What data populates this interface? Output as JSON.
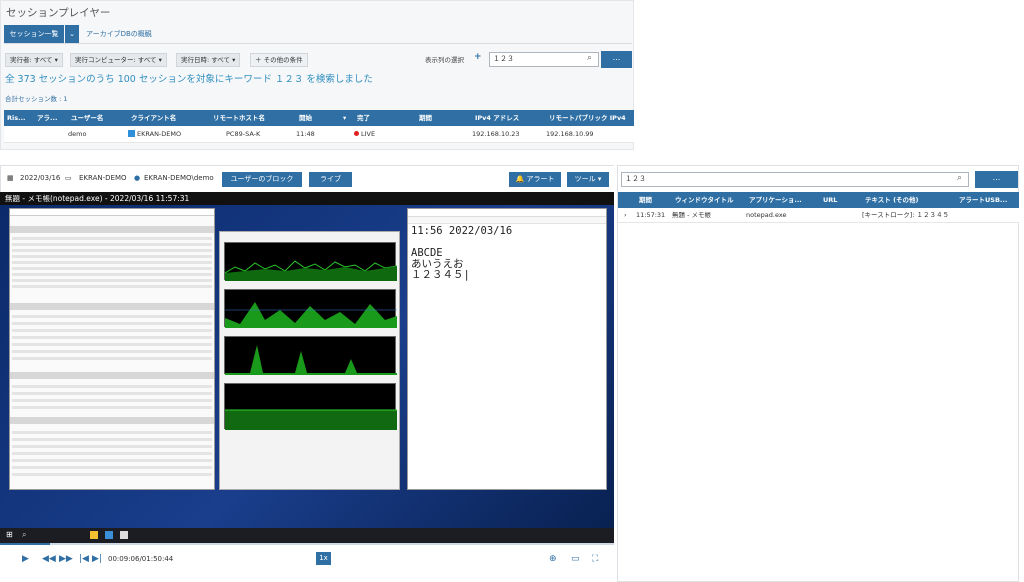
{
  "app": {
    "title": "セッションプレイヤー"
  },
  "tabs": {
    "sessions": "セッション一覧",
    "caret": "⌄",
    "archive": "アーカイブDBの概観"
  },
  "filters": [
    "実行者: すべて ▾",
    "実行コンピューター: すべて ▾",
    "実行日時: すべて ▾"
  ],
  "more_conditions": "＋ その他の条件",
  "columns_select": "表示列の選択",
  "columns_plus": "+",
  "search": {
    "value": "１２３",
    "button": "..."
  },
  "summary": "全 373 セッションのうち 100 セッションを対象にキーワード １２３ を検索しました",
  "total_sessions": "合計セッション数 : 1",
  "table": {
    "headers": [
      "Ris...",
      "アラ...",
      "ユーザー名",
      "クライアント名",
      "リモートホスト名",
      "開始",
      "完了",
      "期間",
      "IPv4 アドレス",
      "リモートパブリック IPv4"
    ],
    "sort_icon": "▾",
    "row": {
      "user": "demo",
      "client": "EKRAN-DEMO",
      "remote_host": "PC89-SA-K",
      "start": "11:48",
      "status": "LIVE",
      "ipv4": "192.168.10.23",
      "public_ipv4": "192.168.10.99"
    }
  },
  "player": {
    "date": "2022/03/16",
    "computer": "EKRAN-DEMO",
    "user": "EKRAN-DEMO\\demo",
    "block_btn": "ユーザーのブロック",
    "live_btn": "ライブ",
    "alert_btn": "🔔 アラート",
    "tools_btn": "ツール ▾",
    "video_title": "無題 - メモ帳(notepad.exe) - 2022/03/16 11:57:31",
    "notepad_text": "11:56 2022/03/16\n\nABCDE\nあいうえお\n１２３４５|",
    "time": "00:09:06/01:50:44",
    "speed": "1x",
    "progress": 0.082
  },
  "right": {
    "search_value": "１２３",
    "button": "...",
    "headers": [
      "",
      "期間",
      "ウィンドウタイトル",
      "アプリケーショ...",
      "URL",
      "テキスト (その他)",
      "アラートUSB..."
    ],
    "row": {
      "time": "11:57:31",
      "window": "無題 - メモ帳",
      "app": "notepad.exe",
      "url": "",
      "text": "[キーストローク]: １２３４５"
    }
  }
}
